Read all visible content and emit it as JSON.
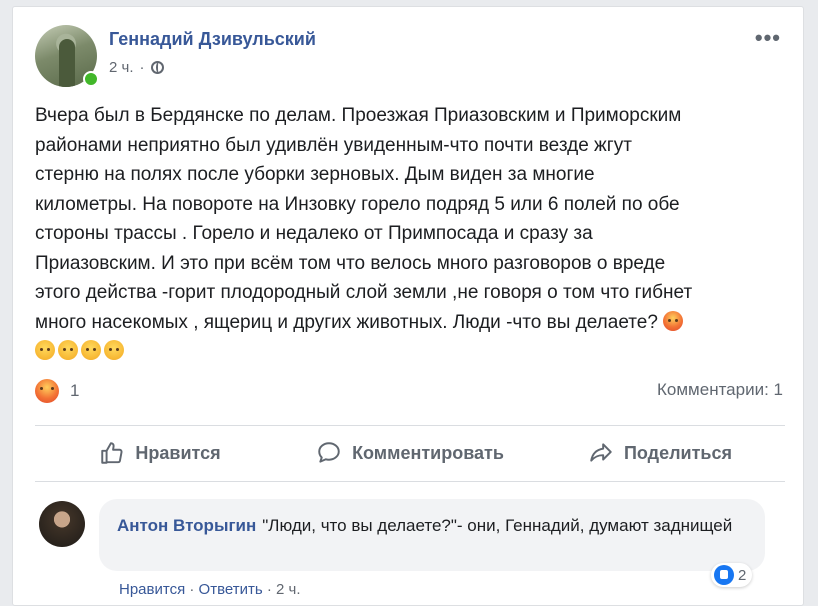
{
  "post": {
    "author": "Геннадий Дзивульский",
    "time": "2 ч.",
    "separator": " · ",
    "text_lines": [
      "Вчера был в Бердянске по делам. Проезжая Приазовским и Приморским",
      "районами неприятно был удивлён увиденным-что почти везде жгут",
      "стерню на полях после уборки зерновых. Дым виден за многие",
      "километры. На повороте на Инзовку горело подряд 5 или 6 полей по обе",
      "стороны трассы . Горело и недалеко от Примпосада и сразу за",
      "Приазовским. И это при всём том что велось много разговоров о вреде",
      "этого действа -горит плодородный слой земли ,не говоря о том что гибнет",
      "много насекомых , ящериц и других животных. Люди -что вы делаете?"
    ],
    "reaction_count": "1",
    "comments_label": "Комментарии: 1"
  },
  "actions": {
    "like": "Нравится",
    "comment": "Комментировать",
    "share": "Поделиться"
  },
  "comment": {
    "author": "Антон Вторыгин",
    "text": "\"Люди, что вы делаете?\"- они, Геннадий, думают заднищей",
    "like_label": "Нравится",
    "reply_label": "Ответить",
    "time": "2 ч.",
    "reaction_count": "2"
  },
  "colors": {
    "link": "#385898",
    "online": "#42b72a",
    "like": "#1877f2"
  }
}
